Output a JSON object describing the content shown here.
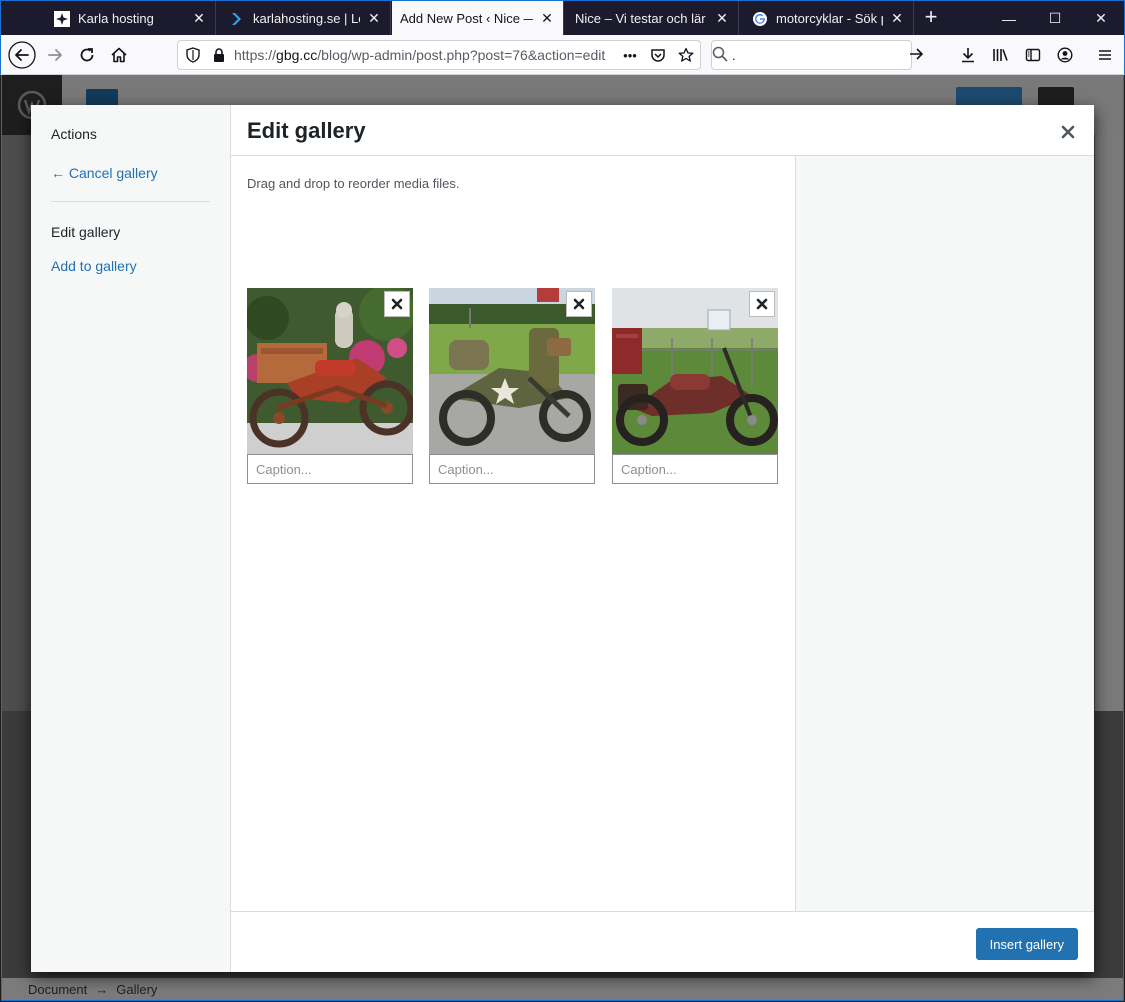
{
  "browser": {
    "tabs": [
      {
        "title": "Karla hosting",
        "favicon": "karla-favicon"
      },
      {
        "title": "karlahosting.se | Login",
        "favicon": "karla-chevron-favicon"
      },
      {
        "title": "Add New Post ‹ Nice — WordPress",
        "favicon": "none",
        "active": true
      },
      {
        "title": "Nice – Vi testar och lär oss",
        "favicon": "none"
      },
      {
        "title": "motorcyklar - Sök på Google",
        "favicon": "google-favicon"
      }
    ],
    "url_host": "gbg.cc",
    "url_prefix": "https://",
    "url_path": "/blog/wp-admin/post.php?post=76&action=edit",
    "search_value": ".",
    "window_controls": [
      "—",
      "☐",
      "✕"
    ]
  },
  "wp": {
    "footer": {
      "crumb1": "Document",
      "arrow": "→",
      "crumb2": "Gallery"
    }
  },
  "modal": {
    "menu": {
      "title": "Actions",
      "cancel_label": "← Cancel gallery",
      "active_label": "Edit gallery",
      "add_label": "Add to gallery"
    },
    "title": "Edit gallery",
    "instructions": "Drag and drop to reorder media files.",
    "attachments": [
      {
        "caption_placeholder": "Caption...",
        "caption_value": ""
      },
      {
        "caption_placeholder": "Caption...",
        "caption_value": ""
      },
      {
        "caption_placeholder": "Caption...",
        "caption_value": ""
      }
    ],
    "insert_label": "Insert gallery"
  },
  "colors": {
    "accent": "#2271b1",
    "link": "#2271b1",
    "browser_tabbar": "#1c1b2e"
  }
}
